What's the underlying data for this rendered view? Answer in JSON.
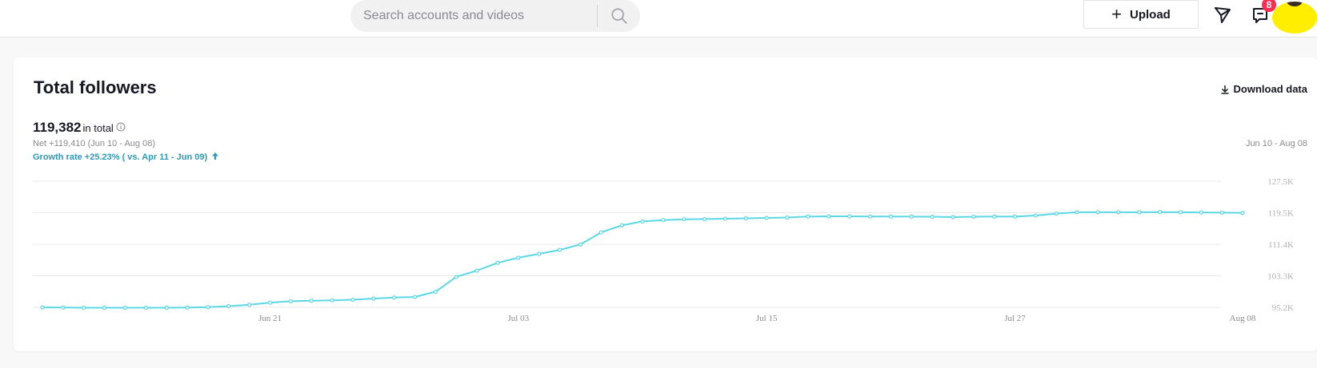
{
  "header": {
    "search_placeholder": "Search accounts and videos",
    "upload_label": "Upload",
    "inbox_badge": "8"
  },
  "card": {
    "title": "Total followers",
    "download_label": "Download data",
    "total_value": "119,382",
    "total_suffix": "in total",
    "net_text": "Net +119,410 (Jun 10 - Aug 08)",
    "growth_text": "Growth rate +25.23% ( vs. Apr 11 - Jun 09)",
    "date_range": "Jun 10 - Aug 08"
  },
  "colors": {
    "line": "#5ad8e6",
    "accent": "#2d9ab8",
    "badge": "#fe2c55",
    "avatar": "#ffee00"
  },
  "chart_data": {
    "type": "line",
    "x_tick_labels": [
      "Jun 21",
      "Jul 03",
      "Jul 15",
      "Jul 27",
      "Aug 08"
    ],
    "y_tick_labels": [
      "127.5K",
      "119.5K",
      "111.4K",
      "103.3K",
      "95.2K"
    ],
    "ylim": [
      95200,
      127500
    ],
    "x_start": "Jun 10",
    "x_end": "Aug 08",
    "grid": true,
    "series": [
      {
        "values": [
          95200,
          95150,
          95100,
          95100,
          95100,
          95100,
          95100,
          95150,
          95250,
          95500,
          95850,
          96400,
          96750,
          96900,
          97000,
          97150,
          97450,
          97700,
          97850,
          99200,
          103000,
          104600,
          106600,
          107900,
          108900,
          109900,
          111300,
          114400,
          116200,
          117200,
          117550,
          117750,
          117800,
          117900,
          118000,
          118100,
          118200,
          118450,
          118500,
          118500,
          118450,
          118450,
          118450,
          118400,
          118300,
          118400,
          118450,
          118450,
          118700,
          119200,
          119550,
          119550,
          119550,
          119550,
          119600,
          119550,
          119500,
          119450,
          119400
        ]
      }
    ]
  }
}
